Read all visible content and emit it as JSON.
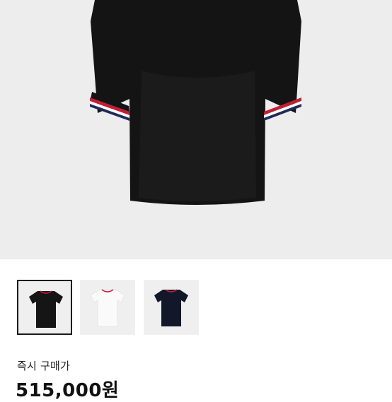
{
  "product": {
    "gallery": [
      {
        "color_name": "black",
        "shirt_color": "#151515",
        "trim": true,
        "selected": true
      },
      {
        "color_name": "white",
        "shirt_color": "#fafafa",
        "trim": true,
        "selected": false
      },
      {
        "color_name": "navy",
        "shirt_color": "#12172a",
        "trim": true,
        "selected": false
      }
    ],
    "main_image_color": "#141414",
    "trim_colors": [
      "#c21f34",
      "#ffffff",
      "#1f2a5a"
    ]
  },
  "purchase": {
    "label": "즉시 구매가",
    "price": "515,000원"
  }
}
